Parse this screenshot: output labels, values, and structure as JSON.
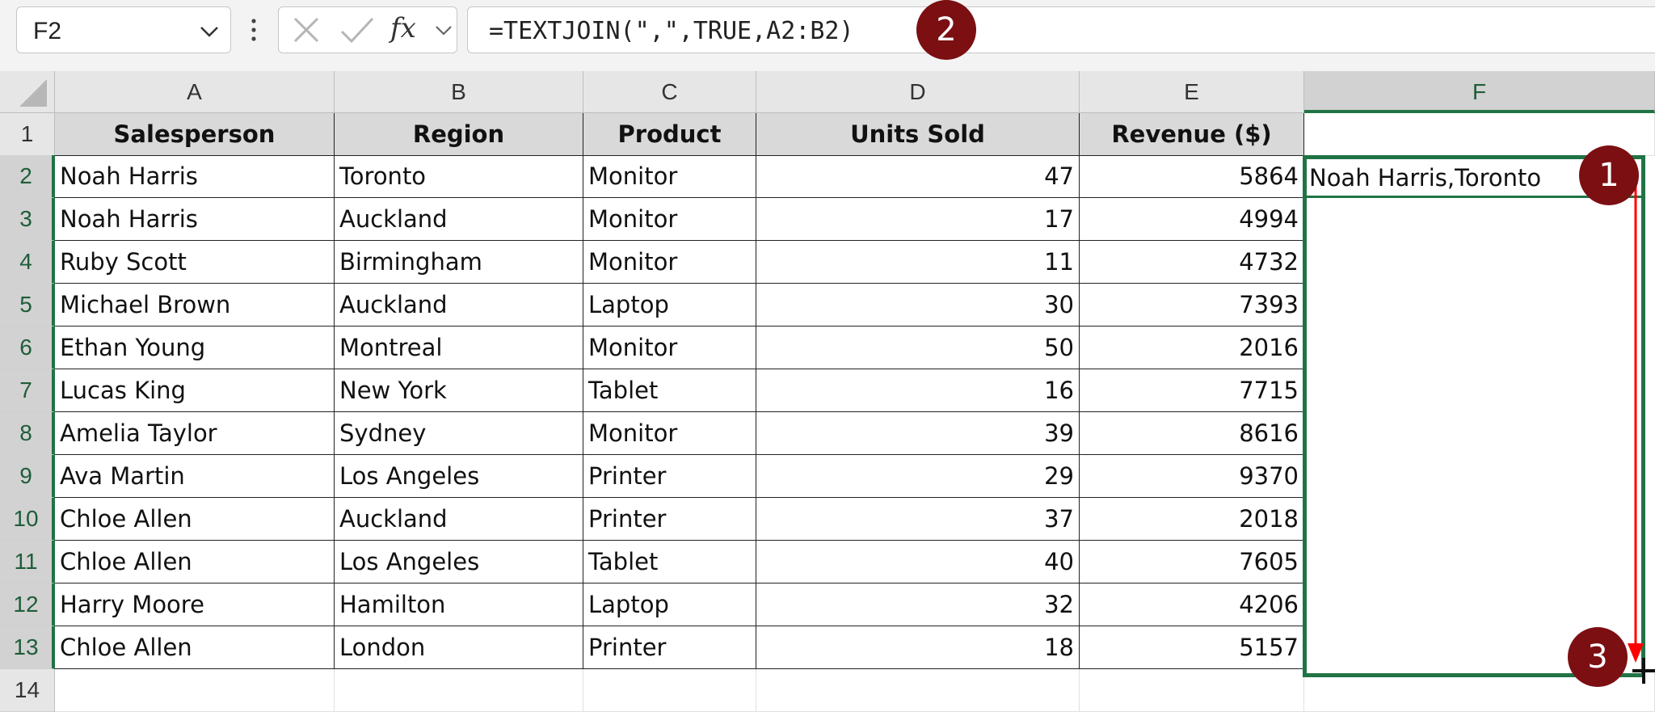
{
  "formula_bar": {
    "name_box": "F2",
    "cancel_icon": "x-icon",
    "enter_icon": "check-icon",
    "fx_label": "fx",
    "formula": "=TEXTJOIN(\",\",TRUE,A2:B2)"
  },
  "columns": [
    "A",
    "B",
    "C",
    "D",
    "E",
    "F"
  ],
  "rows": [
    "1",
    "2",
    "3",
    "4",
    "5",
    "6",
    "7",
    "8",
    "9",
    "10",
    "11",
    "12",
    "13",
    "14"
  ],
  "table": {
    "headers": [
      "Salesperson",
      "Region",
      "Product",
      "Units Sold",
      "Revenue ($)"
    ],
    "rows": [
      [
        "Noah Harris",
        "Toronto",
        "Monitor",
        "47",
        "5864"
      ],
      [
        "Noah Harris",
        "Auckland",
        "Monitor",
        "17",
        "4994"
      ],
      [
        "Ruby Scott",
        "Birmingham",
        "Monitor",
        "11",
        "4732"
      ],
      [
        "Michael Brown",
        "Auckland",
        "Laptop",
        "30",
        "7393"
      ],
      [
        "Ethan Young",
        "Montreal",
        "Monitor",
        "50",
        "2016"
      ],
      [
        "Lucas King",
        "New York",
        "Tablet",
        "16",
        "7715"
      ],
      [
        "Amelia Taylor",
        "Sydney",
        "Monitor",
        "39",
        "8616"
      ],
      [
        "Ava Martin",
        "Los Angeles",
        "Printer",
        "29",
        "9370"
      ],
      [
        "Chloe Allen",
        "Auckland",
        "Printer",
        "37",
        "2018"
      ],
      [
        "Chloe Allen",
        "Los Angeles",
        "Tablet",
        "40",
        "7605"
      ],
      [
        "Harry Moore",
        "Hamilton",
        "Laptop",
        "32",
        "4206"
      ],
      [
        "Chloe Allen",
        "London",
        "Printer",
        "18",
        "5157"
      ]
    ]
  },
  "f2_value": "Noah Harris,Toronto",
  "badges": [
    "1",
    "2",
    "3"
  ],
  "colors": {
    "selection": "#217346",
    "badge": "#7b0f12",
    "arrow": "#ff0000"
  }
}
